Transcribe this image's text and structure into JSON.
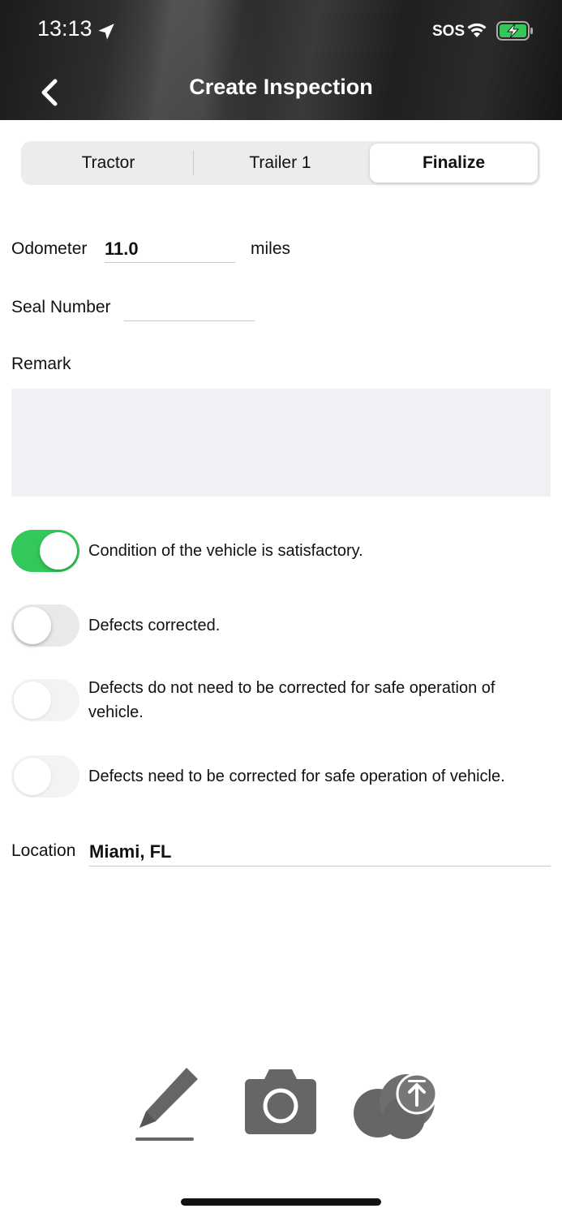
{
  "status_bar": {
    "time": "13:13",
    "sos": "SOS",
    "icons": [
      "location-arrow-icon",
      "wifi-icon",
      "battery-charging-icon"
    ]
  },
  "header": {
    "title": "Create Inspection",
    "back_icon": "chevron-left-icon"
  },
  "tabs": [
    {
      "label": "Tractor",
      "selected": false
    },
    {
      "label": "Trailer 1",
      "selected": false
    },
    {
      "label": "Finalize",
      "selected": true
    }
  ],
  "form": {
    "odometer_label": "Odometer",
    "odometer_value": "11.0",
    "odometer_unit": "miles",
    "seal_label": "Seal Number",
    "seal_value": "",
    "remark_label": "Remark",
    "remark_value": "",
    "location_label": "Location",
    "location_value": "Miami, FL"
  },
  "toggles": [
    {
      "label": "Condition of the vehicle is satisfactory.",
      "on": true
    },
    {
      "label": "Defects corrected.",
      "on": false
    },
    {
      "label": "Defects do not need to be corrected for safe operation of vehicle.",
      "on": false
    },
    {
      "label": "Defects need to be corrected for safe operation of vehicle.",
      "on": false
    }
  ],
  "toolbar": {
    "icons": [
      "pencil-icon",
      "camera-icon",
      "cloud-upload-icon"
    ]
  },
  "colors": {
    "toggle_on": "#34c759",
    "toolbar_icon": "#666666"
  }
}
